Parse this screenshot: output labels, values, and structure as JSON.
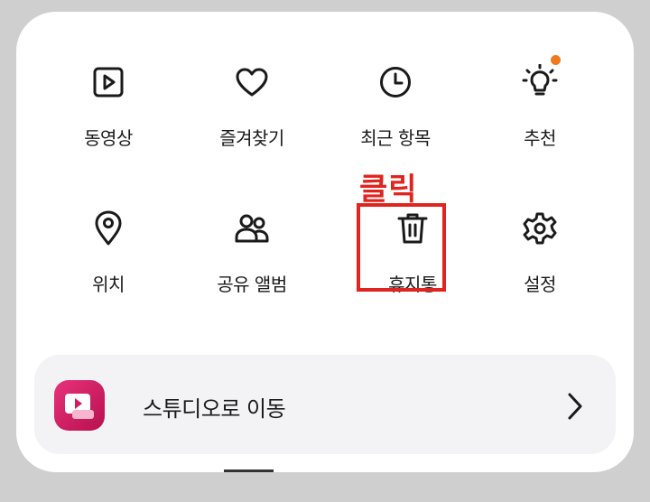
{
  "menu": {
    "items": [
      {
        "label": "동영상",
        "icon": "video-icon"
      },
      {
        "label": "즐겨찾기",
        "icon": "heart-icon"
      },
      {
        "label": "최근 항목",
        "icon": "clock-icon"
      },
      {
        "label": "추천",
        "icon": "lightbulb-icon",
        "badge": "new-dot"
      },
      {
        "label": "위치",
        "icon": "location-pin-icon"
      },
      {
        "label": "공유 앨범",
        "icon": "people-icon"
      },
      {
        "label": "휴지통",
        "icon": "trash-icon"
      },
      {
        "label": "설정",
        "icon": "gear-icon"
      }
    ]
  },
  "annotation": {
    "text": "클릭",
    "color": "#e0241f"
  },
  "studio": {
    "label": "스튜디오로 이동",
    "icon": "studio-app-icon",
    "chevron": "chevron-right-icon"
  },
  "colors": {
    "badge": "#f07a1a",
    "accent": "#d81b60",
    "annotation": "#e0241f"
  }
}
